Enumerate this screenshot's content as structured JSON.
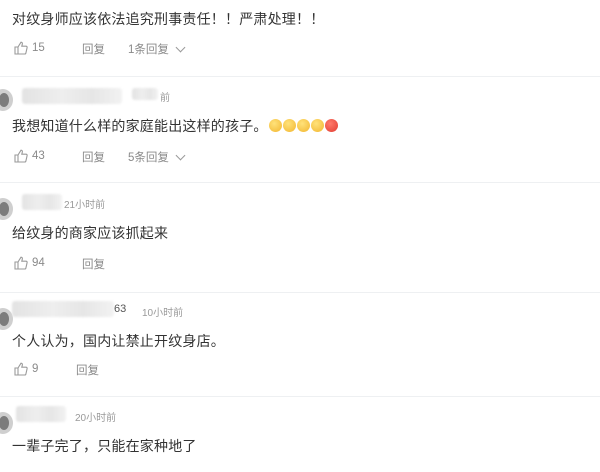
{
  "comments": [
    {
      "text": "对纹身师应该依法追究刑事责任！！严肃处理！！",
      "likes": "15",
      "reply_label": "回复",
      "replies_label": "1条回复"
    },
    {
      "name_suffix": "",
      "time": "前",
      "text": "我想知道什么样的家庭能出这样的孩子。",
      "emojis": [
        "yellow-face",
        "yellow-face",
        "yellow-face",
        "yellow-face",
        "angry-face"
      ],
      "likes": "43",
      "reply_label": "回复",
      "replies_label": "5条回复"
    },
    {
      "time": "21小时前",
      "text": "给纹身的商家应该抓起来",
      "likes": "94",
      "reply_label": "回复"
    },
    {
      "name_suffix": "63",
      "time": "10小时前",
      "text": "个人认为，国内让禁止开纹身店。",
      "likes": "9",
      "reply_label": "回复"
    },
    {
      "time": "20小时前",
      "text": "一辈子完了，只能在家种地了"
    }
  ],
  "colors": {
    "text": "#333333",
    "meta": "#999999",
    "action": "#8a8a8a",
    "divider": "#eef0f2"
  },
  "icons": {
    "like": "thumbs-up-icon",
    "expand": "chevron-down-icon"
  }
}
